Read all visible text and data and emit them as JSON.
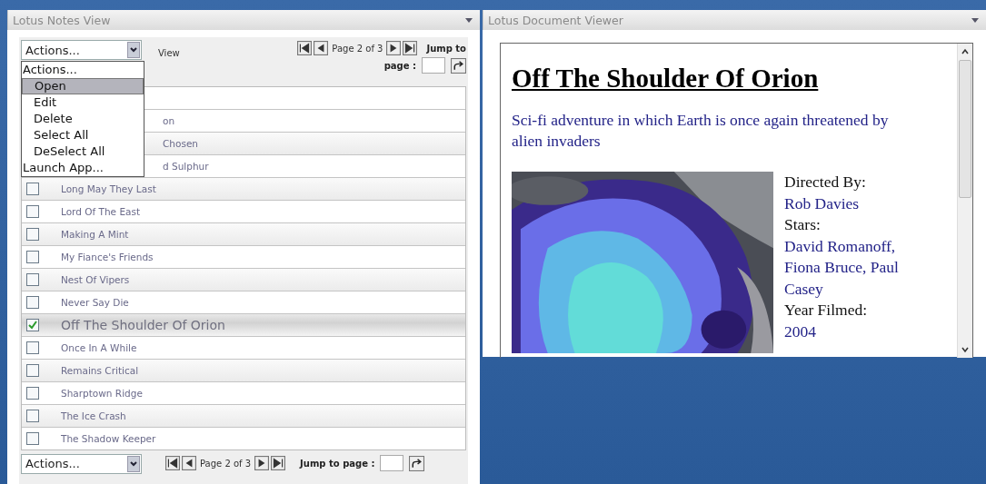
{
  "left_panel": {
    "title": "Lotus Notes View",
    "toolbar": {
      "actions": "Actions...",
      "view_label": "View",
      "pager": "Page 2 of 3",
      "jump_label_1": "Jump to",
      "jump_label_2": "page :"
    },
    "menu": {
      "items": [
        {
          "label": "Actions...",
          "kind": "header",
          "selected": false
        },
        {
          "label": "Open",
          "kind": "option",
          "selected": true
        },
        {
          "label": "Edit",
          "kind": "option",
          "selected": false
        },
        {
          "label": "Delete",
          "kind": "option",
          "selected": false
        },
        {
          "label": "Select All",
          "kind": "option",
          "selected": false
        },
        {
          "label": "DeSelect All",
          "kind": "option",
          "selected": false
        },
        {
          "label": "Launch App...",
          "kind": "header",
          "selected": false
        }
      ]
    },
    "rows": [
      {
        "text": "on",
        "covered": true
      },
      {
        "text": "Chosen",
        "covered": true
      },
      {
        "text": "d Sulphur",
        "covered": true
      },
      {
        "text": "Long May They Last",
        "covered": false,
        "checked": false
      },
      {
        "text": "Lord Of The East",
        "covered": false,
        "checked": false
      },
      {
        "text": "Making A Mint",
        "covered": false,
        "checked": false
      },
      {
        "text": "My Fiance's Friends",
        "covered": false,
        "checked": false
      },
      {
        "text": "Nest Of Vipers",
        "covered": false,
        "checked": false
      },
      {
        "text": "Never Say Die",
        "covered": false,
        "checked": false
      },
      {
        "text": "Off The Shoulder Of Orion",
        "covered": false,
        "checked": true
      },
      {
        "text": "Once In A While",
        "covered": false,
        "checked": false
      },
      {
        "text": "Remains Critical",
        "covered": false,
        "checked": false
      },
      {
        "text": "Sharptown Ridge",
        "covered": false,
        "checked": false
      },
      {
        "text": "The Ice Crash",
        "covered": false,
        "checked": false
      },
      {
        "text": "The Shadow Keeper",
        "covered": false,
        "checked": false
      }
    ],
    "bottom_toolbar": {
      "actions": "Actions...",
      "pager": "Page 2 of 3",
      "jump_label": "Jump to page :"
    }
  },
  "right_panel": {
    "title": "Lotus Document Viewer",
    "document": {
      "heading": "Off The Shoulder Of Orion",
      "summary": "Sci-fi adventure in which Earth is once again threatened by alien invaders",
      "details": [
        {
          "text": "Directed By:",
          "kind": "label"
        },
        {
          "text": "Rob Davies",
          "kind": "value"
        },
        {
          "text": "Stars:",
          "kind": "label"
        },
        {
          "text": "David Romanoff, Fiona Bruce, Paul Casey",
          "kind": "value"
        },
        {
          "text": "Year Filmed:",
          "kind": "label"
        },
        {
          "text": "2004",
          "kind": "value"
        }
      ]
    }
  }
}
